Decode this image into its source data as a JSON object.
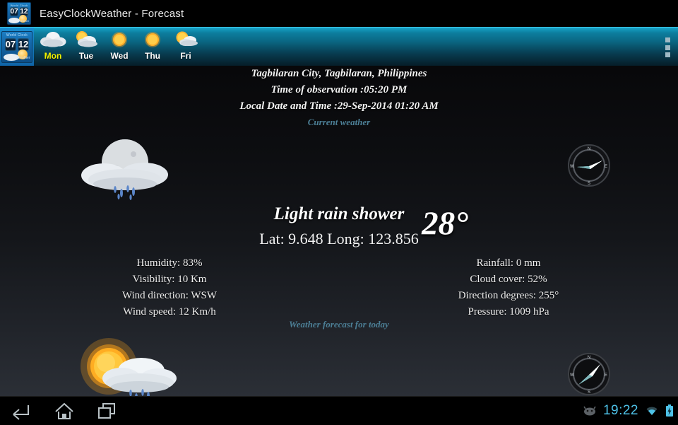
{
  "titlebar": {
    "app_title": "EasyClockWeather - Forecast",
    "icon_name": "app-icon",
    "icon_top_label": "World Clock",
    "icon_hours": "07",
    "icon_minutes": "12",
    "icon_bottom_label": "Weather"
  },
  "actionbar": {
    "home_icon_name": "app-home-icon",
    "overflow_label": "overflow-menu",
    "tabs": [
      {
        "label": "Mon",
        "icon": "cloudy-icon",
        "selected": true
      },
      {
        "label": "Tue",
        "icon": "partly-cloudy-icon",
        "selected": false
      },
      {
        "label": "Wed",
        "icon": "sunny-icon",
        "selected": false
      },
      {
        "label": "Thu",
        "icon": "sunny-icon",
        "selected": false
      },
      {
        "label": "Fri",
        "icon": "partly-cloudy-icon",
        "selected": false
      }
    ]
  },
  "main": {
    "location": "Tagbilaran City, Tagbilaran, Philippines",
    "observation_time": "Time of observation :05:20 PM",
    "local_datetime": "Local Date and Time :29-Sep-2014  01:20 AM",
    "current_weather_heading": "Current weather",
    "today_forecast_heading": "Weather forecast for today",
    "temperature": "28°",
    "condition": "Light rain shower",
    "coordinates": "Lat: 9.648 Long: 123.856",
    "current_icon_name": "night-rain-icon",
    "today_icon_name": "sun-cloud-rain-icon",
    "current_compass_name": "wind-compass-wsw",
    "today_compass_name": "wind-compass-sw",
    "stats_left": [
      "Humidity: 83%",
      "Visibility: 10 Km",
      "Wind direction: WSW",
      "Wind speed: 12 Km/h"
    ],
    "stats_right": [
      "Rainfall: 0 mm",
      "Cloud cover: 52%",
      "Direction degrees: 255°",
      "Pressure: 1009 hPa"
    ],
    "compass_labels": {
      "n": "N",
      "e": "E",
      "s": "S",
      "w": "W"
    }
  },
  "navbar": {
    "back_label": "back-button",
    "home_label": "home-button",
    "recents_label": "recent-apps-button",
    "clock": "19:22",
    "os_icon": "android-jellybean-icon",
    "wifi_icon": "wifi-icon",
    "battery_icon": "battery-charging-icon"
  },
  "colors": {
    "accent_heading": "#4c7f96",
    "selected_tab": "#f2f400",
    "actionbar_top": "#16a3c8",
    "clock": "#4ec2e8"
  }
}
